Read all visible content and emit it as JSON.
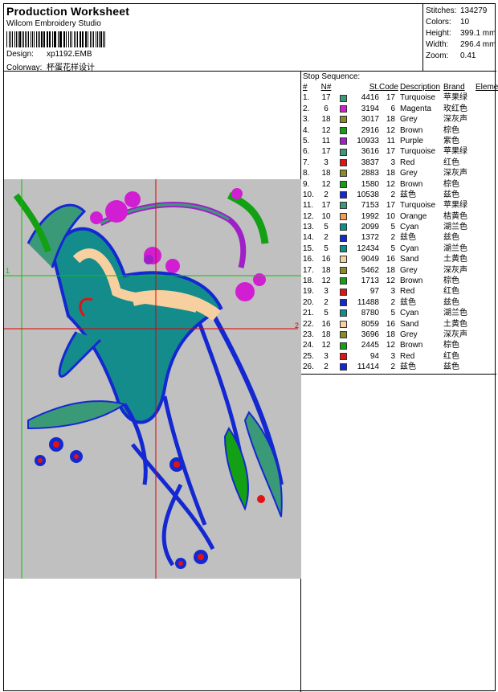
{
  "header": {
    "title": "Production Worksheet",
    "software": "Wilcom Embroidery Studio",
    "design_label": "Design:",
    "design_value": "xp1192.EMB",
    "colorway_label": "Colorway:",
    "colorway_value": "杯蛋花样设计"
  },
  "stats": [
    {
      "label": "Stitches:",
      "value": "134279"
    },
    {
      "label": "Colors:",
      "value": "10"
    },
    {
      "label": "Height:",
      "value": "399.1 mm"
    },
    {
      "label": "Width:",
      "value": "296.4 mm"
    },
    {
      "label": "Zoom:",
      "value": "0.41"
    }
  ],
  "preview": {
    "marker_1": "1",
    "marker_2": "2"
  },
  "sequence": {
    "title": "Stop Sequence:",
    "headers": {
      "idx": "#",
      "n": "N#",
      "st": "St.",
      "code": "Code",
      "desc": "Description",
      "brand": "Brand",
      "elem": "Element"
    },
    "rows": [
      {
        "idx": "1.",
        "n": "17",
        "color": "#3a9a78",
        "st": "4416",
        "code": "17",
        "desc": "Turquoise",
        "brand": "苹果绿"
      },
      {
        "idx": "2.",
        "n": "6",
        "color": "#d21ed2",
        "st": "3194",
        "code": "6",
        "desc": "Magenta",
        "brand": "玫红色"
      },
      {
        "idx": "3.",
        "n": "18",
        "color": "#8a8a28",
        "st": "3017",
        "code": "18",
        "desc": "Grey",
        "brand": "深灰声"
      },
      {
        "idx": "4.",
        "n": "12",
        "color": "#14a014",
        "st": "2916",
        "code": "12",
        "desc": "Brown",
        "brand": "棕色"
      },
      {
        "idx": "5.",
        "n": "11",
        "color": "#a020c8",
        "st": "10933",
        "code": "11",
        "desc": "Purple",
        "brand": "紫色"
      },
      {
        "idx": "6.",
        "n": "17",
        "color": "#3a9a78",
        "st": "3616",
        "code": "17",
        "desc": "Turquoise",
        "brand": "苹果绿"
      },
      {
        "idx": "7.",
        "n": "3",
        "color": "#e01414",
        "st": "3837",
        "code": "3",
        "desc": "Red",
        "brand": "红色"
      },
      {
        "idx": "8.",
        "n": "18",
        "color": "#8a8a28",
        "st": "2883",
        "code": "18",
        "desc": "Grey",
        "brand": "深灰声"
      },
      {
        "idx": "9.",
        "n": "12",
        "color": "#14a014",
        "st": "1580",
        "code": "12",
        "desc": "Brown",
        "brand": "棕色"
      },
      {
        "idx": "10.",
        "n": "2",
        "color": "#1428d2",
        "st": "10538",
        "code": "2",
        "desc": "兹色",
        "brand": "兹色"
      },
      {
        "idx": "11.",
        "n": "17",
        "color": "#3a9a78",
        "st": "7153",
        "code": "17",
        "desc": "Turquoise",
        "brand": "苹果绿"
      },
      {
        "idx": "12.",
        "n": "10",
        "color": "#f0a050",
        "st": "1992",
        "code": "10",
        "desc": "Orange",
        "brand": "桔黄色"
      },
      {
        "idx": "13.",
        "n": "5",
        "color": "#148c8c",
        "st": "2099",
        "code": "5",
        "desc": "Cyan",
        "brand": "湖兰色"
      },
      {
        "idx": "14.",
        "n": "2",
        "color": "#1428d2",
        "st": "1372",
        "code": "2",
        "desc": "兹色",
        "brand": "兹色"
      },
      {
        "idx": "15.",
        "n": "5",
        "color": "#148c8c",
        "st": "12434",
        "code": "5",
        "desc": "Cyan",
        "brand": "湖兰色"
      },
      {
        "idx": "16.",
        "n": "16",
        "color": "#f8d0a0",
        "st": "9049",
        "code": "16",
        "desc": "Sand",
        "brand": "土黄色"
      },
      {
        "idx": "17.",
        "n": "18",
        "color": "#8a8a28",
        "st": "5462",
        "code": "18",
        "desc": "Grey",
        "brand": "深灰声"
      },
      {
        "idx": "18.",
        "n": "12",
        "color": "#14a014",
        "st": "1713",
        "code": "12",
        "desc": "Brown",
        "brand": "棕色"
      },
      {
        "idx": "19.",
        "n": "3",
        "color": "#e01414",
        "st": "97",
        "code": "3",
        "desc": "Red",
        "brand": "红色"
      },
      {
        "idx": "20.",
        "n": "2",
        "color": "#1428d2",
        "st": "11488",
        "code": "2",
        "desc": "兹色",
        "brand": "兹色"
      },
      {
        "idx": "21.",
        "n": "5",
        "color": "#148c8c",
        "st": "8780",
        "code": "5",
        "desc": "Cyan",
        "brand": "湖兰色"
      },
      {
        "idx": "22.",
        "n": "16",
        "color": "#f8d0a0",
        "st": "8059",
        "code": "16",
        "desc": "Sand",
        "brand": "土黄色"
      },
      {
        "idx": "23.",
        "n": "18",
        "color": "#8a8a28",
        "st": "3696",
        "code": "18",
        "desc": "Grey",
        "brand": "深灰声"
      },
      {
        "idx": "24.",
        "n": "12",
        "color": "#14a014",
        "st": "2445",
        "code": "12",
        "desc": "Brown",
        "brand": "棕色"
      },
      {
        "idx": "25.",
        "n": "3",
        "color": "#e01414",
        "st": "94",
        "code": "3",
        "desc": "Red",
        "brand": "红色"
      },
      {
        "idx": "26.",
        "n": "2",
        "color": "#1428d2",
        "st": "11414",
        "code": "2",
        "desc": "兹色",
        "brand": "兹色"
      }
    ]
  },
  "colors": {
    "design_bg": "#c0c0c0",
    "guide_green": "#00c800",
    "guide_red": "#e00000"
  }
}
